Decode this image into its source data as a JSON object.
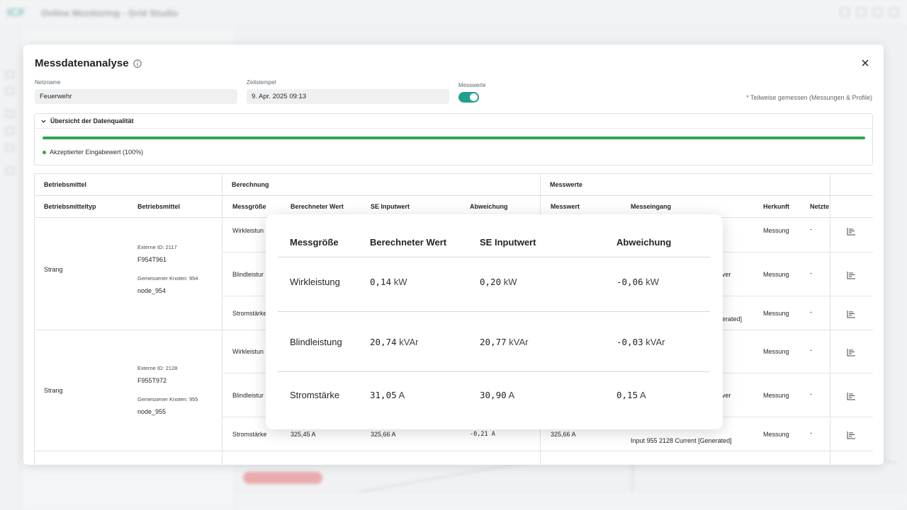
{
  "app": {
    "logo": "ICF",
    "title": "Online Monitoring - Grid Studio"
  },
  "modal": {
    "title": "Messdatenanalyse",
    "fields": {
      "netzname_label": "Netzname",
      "netzname_value": "Feuerwehr",
      "zeitstempel_label": "Zeitstempel",
      "zeitstempel_value": "9. Apr. 2025 09:13",
      "messwerte_label": "Messwerte",
      "messwerte_on": true
    },
    "partial_note": "* Teilweise gemessen (Messungen & Profile)",
    "quality": {
      "title": "Übersicht der Datenqualität",
      "accepted_fraction": 1.0,
      "legend": "Akzeptierter Eingabewert (100%)",
      "color": "#2fa64f"
    },
    "table": {
      "groups": [
        "Betriebsmittel",
        "Berechnung",
        "Messwerte"
      ],
      "columns": [
        "Betriebsmitteltyp",
        "Betriebsmittel",
        "Messgröße",
        "Berechneter Wert",
        "SE Inputwert",
        "Abweichung",
        "Messwert",
        "Messeingang",
        "Herkunft",
        "Netzte"
      ],
      "assets": [
        {
          "type": "Strang",
          "ext_id": "Externe ID: 2117",
          "name": "F954T961",
          "node_label": "Gemessener Knoten: 954",
          "node": "node_954"
        },
        {
          "type": "Strang",
          "ext_id": "Externe ID: 2128",
          "name": "F955T972",
          "node_label": "Gemessener Knoten: 955",
          "node": "node_955"
        }
      ],
      "rows": [
        {
          "quantity": "Wirkleistun",
          "herkunft": "Messung",
          "netz": "-",
          "eingang": ""
        },
        {
          "quantity": "Blindleistur",
          "herkunft": "Messung",
          "netz": "-",
          "eingang": "ver"
        },
        {
          "quantity": "Stromstärke",
          "herkunft": "Messung",
          "netz": "-",
          "eingang": "erated]"
        },
        {
          "quantity": "Wirkleistun",
          "herkunft": "Messung",
          "netz": "-",
          "eingang": ""
        },
        {
          "quantity": "Blindleistur",
          "herkunft": "Messung",
          "netz": "-",
          "eingang": "ver"
        },
        {
          "quantity": "Stromstärke",
          "berechnet": "325,45 A",
          "se": "325,66 A",
          "abw": "-0,21 A",
          "messwert": "325,66 A",
          "eingang": "Input 955 2128 Current [Generated]",
          "herkunft": "Messung",
          "netz": "-"
        }
      ]
    }
  },
  "popover": {
    "headers": [
      "Messgröße",
      "Berechneter Wert",
      "SE Inputwert",
      "Abweichung"
    ],
    "rows": [
      {
        "name": "Wirkleistung",
        "calc": "0,14",
        "calc_unit": "kW",
        "se": "0,20",
        "se_unit": "kW",
        "dev": "-0,06",
        "dev_unit": "kW"
      },
      {
        "name": "Blindleistung",
        "calc": "20,74",
        "calc_unit": "kVAr",
        "se": "20,77",
        "se_unit": "kVAr",
        "dev": "-0,03",
        "dev_unit": "kVAr"
      },
      {
        "name": "Stromstärke",
        "calc": "31,05",
        "calc_unit": "A",
        "se": "30,90",
        "se_unit": "A",
        "dev": "0,15",
        "dev_unit": "A"
      }
    ]
  }
}
